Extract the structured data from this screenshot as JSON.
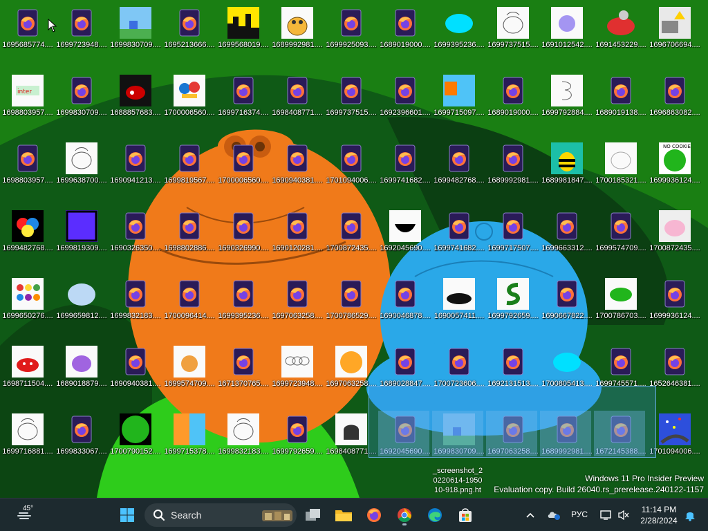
{
  "desktop": {
    "icons": [
      [
        "1695685774....",
        "1699723948....",
        "1699830709....",
        "1695213666....",
        "1699568019....",
        "1689992981....",
        "1699925093....",
        "1689019000....",
        "1699395236....",
        "1699737515....",
        "1691012542....",
        "1691453229....",
        "1696706694...."
      ],
      [
        "1698803957....",
        "1699830709....",
        "1688857683....",
        "1700006560....",
        "1699716374....",
        "1698408771....",
        "1699737515....",
        "1692396601....",
        "1699715097....",
        "1689019000....",
        "1699792884....",
        "1689019138....",
        "1696863082...."
      ],
      [
        "1698803957....",
        "1699638700....",
        "1690941213....",
        "1699819567....",
        "1700006560....",
        "1690940381....",
        "1701094006....",
        "1699741682....",
        "1699482768....",
        "1689992981....",
        "1689981847....",
        "1700185321....",
        "1699936124...."
      ],
      [
        "1699482768....",
        "1699819309....",
        "1690326350....",
        "1698802886....",
        "1690326990....",
        "1690120281....",
        "1700872435....",
        "1692045690....",
        "1699741682....",
        "1699717507....",
        "1699663312....",
        "1699574709....",
        "1700872435...."
      ],
      [
        "1699650276....",
        "1699659812....",
        "1699832183....",
        "1700096414....",
        "1699395236....",
        "1697063258....",
        "1700786529....",
        "1690046878....",
        "1690057411....",
        "1699792659....",
        "1690667822....",
        "1700786703....",
        "1699936124...."
      ],
      [
        "1698711504....",
        "1689018879....",
        "1690940381....",
        "1699574709....",
        "1671370765....",
        "1699723948....",
        "1697063258....",
        "1689028847....",
        "1700723606....",
        "1692131513....",
        "1700805413....",
        "1699745571....",
        "1652646381...."
      ],
      [
        "1699716881....",
        "1699833067....",
        "1700790152....",
        "1699715378....",
        "1699832183....",
        "1699792659....",
        "1698408771....",
        "1692045690....",
        "1699830709....",
        "1697063258....",
        "1689992981....",
        "1672145388....",
        "1701094006...."
      ]
    ]
  },
  "drag_tooltip": [
    "_screenshot_2",
    "0220614-1950",
    "10-918.png.ht"
  ],
  "watermark": {
    "line1": "Windows 11 Pro Insider Preview",
    "line2": "Evaluation copy. Build 26040.rs_prerelease.240122-1157"
  },
  "taskbar": {
    "weather_temp": "45°",
    "search_label": "Search",
    "language": "РУС",
    "time": "11:14 PM",
    "date": "2/28/2024",
    "icons": [
      "start-icon",
      "search-icon",
      "task-view-icon",
      "file-explorer-icon",
      "firefox-icon",
      "chrome-icon",
      "edge-icon",
      "store-icon"
    ]
  },
  "colors": {
    "wallpaper_green": "#1a7f13",
    "wallpaper_dark": "#0e4a14",
    "orange_creature": "#f07a1a",
    "blue_creature": "#2aa8e8",
    "taskbar_bg": "#1d2a2f",
    "selection": "#3c8cdc"
  }
}
